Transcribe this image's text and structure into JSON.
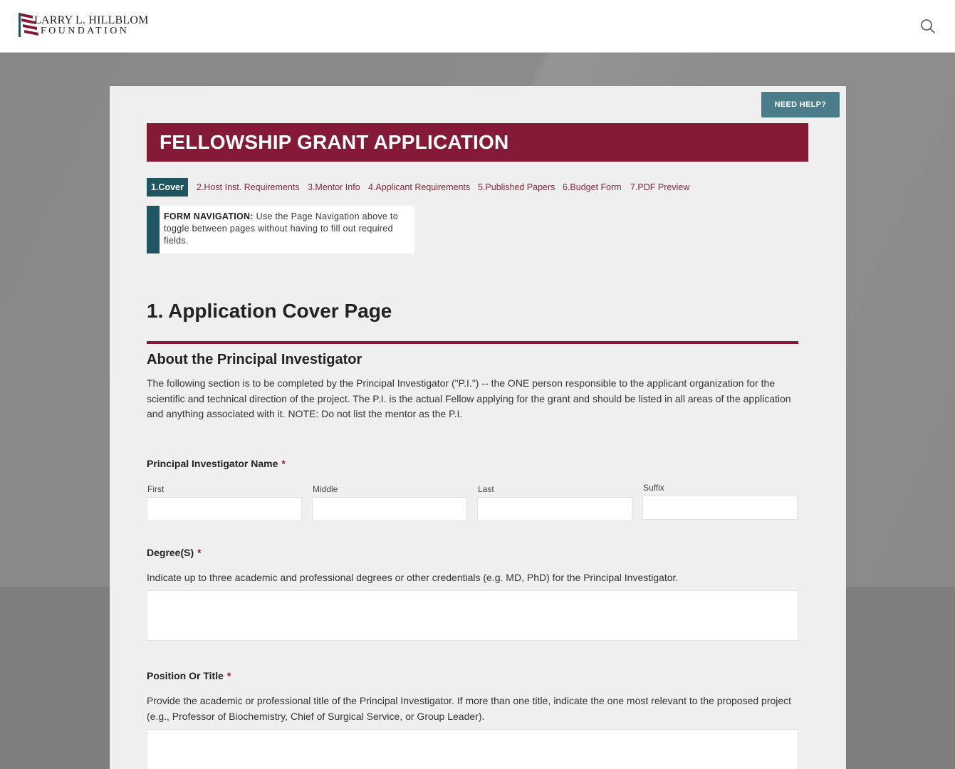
{
  "header": {
    "logo_line1": "LARRY L. HILLBLOM",
    "logo_line2": "FOUNDATION",
    "search_icon": "search-icon"
  },
  "help_button": {
    "label": "NEED HELP?"
  },
  "form_title": "FELLOWSHIP GRANT APPLICATION",
  "tabs": [
    {
      "label": "1.Cover",
      "active": true
    },
    {
      "label": "2.Host Inst. Requirements"
    },
    {
      "label": "3.Mentor Info"
    },
    {
      "label": "4.Applicant Requirements"
    },
    {
      "label": "5.Published Papers"
    },
    {
      "label": "6.Budget Form"
    },
    {
      "label": "7.PDF Preview"
    }
  ],
  "notice": {
    "heading": "FORM NAVIGATION:",
    "body": "Use the Page Navigation above to toggle between pages without having to fill out required fields."
  },
  "page_title": "1. Application Cover Page",
  "section": {
    "title": "About the Principal Investigator",
    "description": "The following section is to be completed by the Principal Investigator (\"P.I.\") -- the ONE person responsible to the applicant organization for the scientific and technical direction of the project. The P.I. is the actual Fellow applying for the grant and should be listed in all areas of the application and anything associated with it. NOTE: Do not list the mentor as the P.I."
  },
  "fields": {
    "pi_name": {
      "label": "Principal Investigator Name",
      "required_mark": "*",
      "parts": [
        "First",
        "Middle",
        "Last",
        "Suffix"
      ]
    },
    "degrees": {
      "label": "Degree(S)",
      "required_mark": "*",
      "help": "Indicate up to three academic and professional degrees or other credentials (e.g. MD, PhD) for the Principal Investigator."
    },
    "position": {
      "label": "Position Or Title",
      "required_mark": "*",
      "help": "Provide the academic or professional title of the Principal Investigator. If more than one title, indicate the one most relevant to the proposed project (e.g., Professor of Biochemistry, Chief of Surgical Service, or Group Leader)."
    }
  },
  "colors": {
    "brand_maroon": "#841a36",
    "teal": "#1f5561",
    "help_button": "#4a7c8a",
    "card_bg": "#efefef"
  }
}
